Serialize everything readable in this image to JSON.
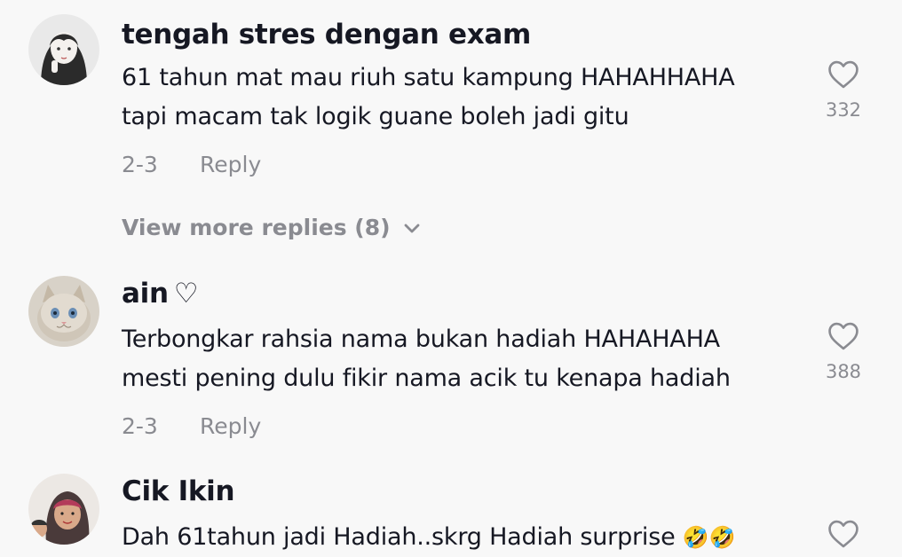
{
  "comments": [
    {
      "username": "tengah stres dengan exam",
      "line1": "61 tahun mat mau riuh satu kampung HAHAHHAHA",
      "line2": "tapi macam tak logik guane boleh jadi gitu",
      "date": "2-3",
      "reply_label": "Reply",
      "likes": "332",
      "view_more": "View more replies (8)"
    },
    {
      "username": "ain",
      "username_suffix": "♡",
      "line1": "Terbongkar rahsia nama bukan hadiah HAHAHAHA",
      "line2": "mesti pening dulu fikir nama acik tu kenapa hadiah",
      "date": "2-3",
      "reply_label": "Reply",
      "likes": "388"
    },
    {
      "username": "Cik Ikin",
      "line1": "Dah 61tahun jadi Hadiah..skrg Hadiah surprise",
      "emoji": "🤣🤣"
    }
  ],
  "colors": {
    "background": "#f8f8f8",
    "primary_text": "#161823",
    "secondary_text": "#8a8b91"
  },
  "icons": [
    "heart-outline-icon",
    "chevron-down-icon"
  ]
}
